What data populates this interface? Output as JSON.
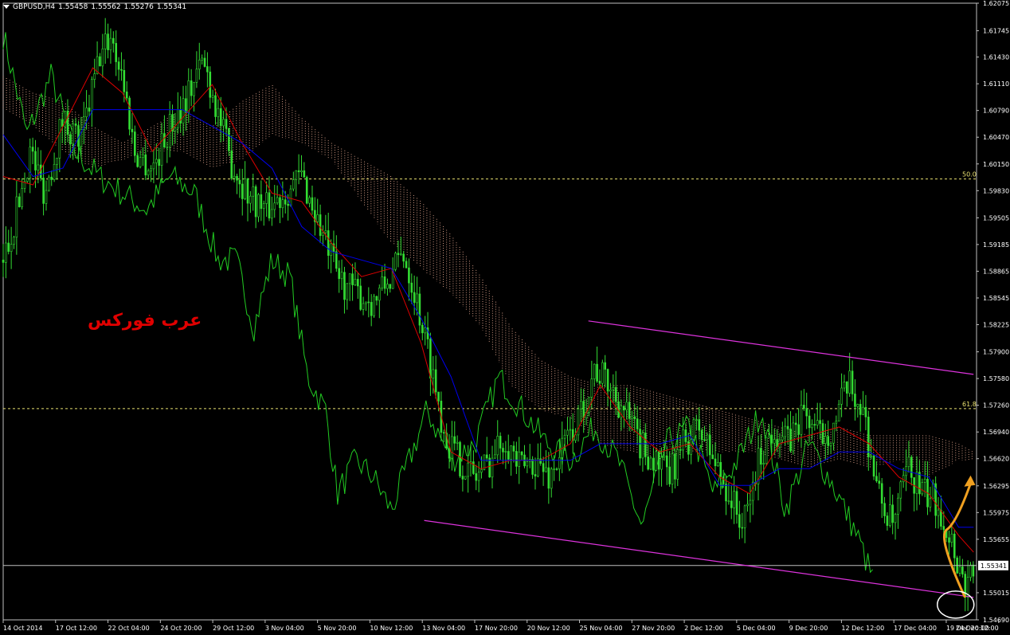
{
  "header": {
    "symbol": "GBPUSD,H4",
    "open": "1.55458",
    "high": "1.55562",
    "low": "1.55276",
    "close": "1.55341"
  },
  "watermark": "عرب فوركس",
  "colors": {
    "background": "#000000",
    "price": "#33dd33",
    "tenkan": "#dd0000",
    "kijun": "#0000ee",
    "chikou": "#22cc22",
    "cloud_bull": "#f5b49a",
    "cloud_bear": "#dddddd",
    "channel": "#dd33dd",
    "arrow": "#f0a020",
    "fib": "#e8e070",
    "current_price_line": "#c0c0c0"
  },
  "icons": {
    "menu": "triangle-down-icon",
    "forecast": "curved-arrow-icon",
    "highlight": "ellipse-marker"
  },
  "chart_data": {
    "type": "candlestick",
    "instrument": "GBPUSD",
    "timeframe": "H4",
    "ylim": [
      1.5469,
      1.62075
    ],
    "y_ticks": [
      "1.62075",
      "1.61745",
      "1.61430",
      "1.61110",
      "1.60790",
      "1.60470",
      "1.60150",
      "1.59830",
      "1.59505",
      "1.59185",
      "1.58865",
      "1.58545",
      "1.58225",
      "1.57900",
      "1.57580",
      "1.57260",
      "1.56940",
      "1.56620",
      "1.56295",
      "1.55975",
      "1.55655",
      "1.55015",
      "1.54690"
    ],
    "x_labels": [
      "14 Oct 2014",
      "17 Oct 12:00",
      "22 Oct 04:00",
      "24 Oct 20:00",
      "29 Oct 12:00",
      "3 Nov 04:00",
      "5 Nov 20:00",
      "10 Nov 12:00",
      "13 Nov 04:00",
      "17 Nov 20:00",
      "20 Nov 12:00",
      "25 Nov 04:00",
      "27 Nov 20:00",
      "2 Dec 12:00",
      "5 Dec 04:00",
      "9 Dec 20:00",
      "12 Dec 12:00",
      "17 Dec 04:00",
      "19 Dec 20:00",
      "24 Dec 12:00"
    ],
    "current_price": 1.55341,
    "current_price_label": "1.55341",
    "fib_levels": [
      {
        "label": "50.0",
        "price": 1.5997
      },
      {
        "label": "61.8",
        "price": 1.5722
      }
    ],
    "close_path": [
      {
        "t": 0,
        "p": 1.59
      },
      {
        "t": 4,
        "p": 1.595
      },
      {
        "t": 9,
        "p": 1.603
      },
      {
        "t": 14,
        "p": 1.598
      },
      {
        "t": 20,
        "p": 1.607
      },
      {
        "t": 26,
        "p": 1.604
      },
      {
        "t": 32,
        "p": 1.614
      },
      {
        "t": 36,
        "p": 1.617
      },
      {
        "t": 40,
        "p": 1.612
      },
      {
        "t": 44,
        "p": 1.603
      },
      {
        "t": 50,
        "p": 1.601
      },
      {
        "t": 56,
        "p": 1.606
      },
      {
        "t": 62,
        "p": 1.61
      },
      {
        "t": 67,
        "p": 1.614
      },
      {
        "t": 71,
        "p": 1.609
      },
      {
        "t": 76,
        "p": 1.602
      },
      {
        "t": 82,
        "p": 1.598
      },
      {
        "t": 88,
        "p": 1.596
      },
      {
        "t": 94,
        "p": 1.598
      },
      {
        "t": 100,
        "p": 1.6
      },
      {
        "t": 106,
        "p": 1.594
      },
      {
        "t": 112,
        "p": 1.588
      },
      {
        "t": 118,
        "p": 1.586
      },
      {
        "t": 124,
        "p": 1.585
      },
      {
        "t": 130,
        "p": 1.588
      },
      {
        "t": 134,
        "p": 1.591
      },
      {
        "t": 138,
        "p": 1.586
      },
      {
        "t": 143,
        "p": 1.578
      },
      {
        "t": 148,
        "p": 1.569
      },
      {
        "t": 153,
        "p": 1.566
      },
      {
        "t": 158,
        "p": 1.564
      },
      {
        "t": 163,
        "p": 1.566
      },
      {
        "t": 168,
        "p": 1.569
      },
      {
        "t": 173,
        "p": 1.565
      },
      {
        "t": 178,
        "p": 1.566
      },
      {
        "t": 183,
        "p": 1.564
      },
      {
        "t": 188,
        "p": 1.568
      },
      {
        "t": 193,
        "p": 1.571
      },
      {
        "t": 198,
        "p": 1.577
      },
      {
        "t": 203,
        "p": 1.575
      },
      {
        "t": 208,
        "p": 1.572
      },
      {
        "t": 213,
        "p": 1.568
      },
      {
        "t": 218,
        "p": 1.566
      },
      {
        "t": 223,
        "p": 1.564
      },
      {
        "t": 228,
        "p": 1.568
      },
      {
        "t": 233,
        "p": 1.57
      },
      {
        "t": 238,
        "p": 1.566
      },
      {
        "t": 243,
        "p": 1.562
      },
      {
        "t": 248,
        "p": 1.558
      },
      {
        "t": 253,
        "p": 1.566
      },
      {
        "t": 258,
        "p": 1.57
      },
      {
        "t": 263,
        "p": 1.568
      },
      {
        "t": 268,
        "p": 1.572
      },
      {
        "t": 273,
        "p": 1.569
      },
      {
        "t": 278,
        "p": 1.57
      },
      {
        "t": 283,
        "p": 1.575
      },
      {
        "t": 288,
        "p": 1.572
      },
      {
        "t": 293,
        "p": 1.562
      },
      {
        "t": 298,
        "p": 1.558
      },
      {
        "t": 303,
        "p": 1.565
      },
      {
        "t": 308,
        "p": 1.562
      },
      {
        "t": 313,
        "p": 1.561
      },
      {
        "t": 318,
        "p": 1.556
      },
      {
        "t": 322,
        "p": 1.551
      },
      {
        "t": 325,
        "p": 1.5534
      }
    ],
    "tenkan_path": [
      {
        "t": 0,
        "p": 1.6
      },
      {
        "t": 10,
        "p": 1.599
      },
      {
        "t": 20,
        "p": 1.606
      },
      {
        "t": 30,
        "p": 1.613
      },
      {
        "t": 40,
        "p": 1.61
      },
      {
        "t": 50,
        "p": 1.603
      },
      {
        "t": 60,
        "p": 1.607
      },
      {
        "t": 70,
        "p": 1.611
      },
      {
        "t": 80,
        "p": 1.604
      },
      {
        "t": 90,
        "p": 1.598
      },
      {
        "t": 100,
        "p": 1.597
      },
      {
        "t": 110,
        "p": 1.592
      },
      {
        "t": 120,
        "p": 1.588
      },
      {
        "t": 130,
        "p": 1.589
      },
      {
        "t": 140,
        "p": 1.58
      },
      {
        "t": 150,
        "p": 1.567
      },
      {
        "t": 160,
        "p": 1.565
      },
      {
        "t": 170,
        "p": 1.566
      },
      {
        "t": 180,
        "p": 1.566
      },
      {
        "t": 190,
        "p": 1.568
      },
      {
        "t": 200,
        "p": 1.575
      },
      {
        "t": 210,
        "p": 1.57
      },
      {
        "t": 220,
        "p": 1.567
      },
      {
        "t": 230,
        "p": 1.568
      },
      {
        "t": 240,
        "p": 1.564
      },
      {
        "t": 250,
        "p": 1.562
      },
      {
        "t": 260,
        "p": 1.568
      },
      {
        "t": 270,
        "p": 1.569
      },
      {
        "t": 280,
        "p": 1.57
      },
      {
        "t": 290,
        "p": 1.568
      },
      {
        "t": 300,
        "p": 1.564
      },
      {
        "t": 310,
        "p": 1.562
      },
      {
        "t": 320,
        "p": 1.557
      },
      {
        "t": 325,
        "p": 1.555
      }
    ],
    "kijun_path": [
      {
        "t": 0,
        "p": 1.605
      },
      {
        "t": 10,
        "p": 1.6
      },
      {
        "t": 20,
        "p": 1.601
      },
      {
        "t": 30,
        "p": 1.608
      },
      {
        "t": 40,
        "p": 1.608
      },
      {
        "t": 50,
        "p": 1.608
      },
      {
        "t": 60,
        "p": 1.608
      },
      {
        "t": 70,
        "p": 1.606
      },
      {
        "t": 80,
        "p": 1.604
      },
      {
        "t": 90,
        "p": 1.601
      },
      {
        "t": 100,
        "p": 1.594
      },
      {
        "t": 110,
        "p": 1.591
      },
      {
        "t": 120,
        "p": 1.59
      },
      {
        "t": 130,
        "p": 1.589
      },
      {
        "t": 140,
        "p": 1.583
      },
      {
        "t": 150,
        "p": 1.576
      },
      {
        "t": 160,
        "p": 1.566
      },
      {
        "t": 170,
        "p": 1.566
      },
      {
        "t": 180,
        "p": 1.566
      },
      {
        "t": 190,
        "p": 1.566
      },
      {
        "t": 200,
        "p": 1.568
      },
      {
        "t": 210,
        "p": 1.568
      },
      {
        "t": 220,
        "p": 1.568
      },
      {
        "t": 230,
        "p": 1.569
      },
      {
        "t": 240,
        "p": 1.563
      },
      {
        "t": 250,
        "p": 1.563
      },
      {
        "t": 260,
        "p": 1.565
      },
      {
        "t": 270,
        "p": 1.565
      },
      {
        "t": 280,
        "p": 1.567
      },
      {
        "t": 290,
        "p": 1.567
      },
      {
        "t": 300,
        "p": 1.565
      },
      {
        "t": 310,
        "p": 1.564
      },
      {
        "t": 320,
        "p": 1.558
      },
      {
        "t": 325,
        "p": 1.558
      }
    ],
    "chikou_path": [
      {
        "t": 0,
        "p": 1.617
      },
      {
        "t": 8,
        "p": 1.605
      },
      {
        "t": 16,
        "p": 1.612
      },
      {
        "t": 24,
        "p": 1.603
      },
      {
        "t": 32,
        "p": 1.6
      },
      {
        "t": 40,
        "p": 1.598
      },
      {
        "t": 48,
        "p": 1.596
      },
      {
        "t": 56,
        "p": 1.6
      },
      {
        "t": 64,
        "p": 1.598
      },
      {
        "t": 72,
        "p": 1.59
      },
      {
        "t": 78,
        "p": 1.59
      },
      {
        "t": 84,
        "p": 1.582
      },
      {
        "t": 90,
        "p": 1.59
      },
      {
        "t": 96,
        "p": 1.588
      },
      {
        "t": 102,
        "p": 1.576
      },
      {
        "t": 108,
        "p": 1.572
      },
      {
        "t": 112,
        "p": 1.562
      },
      {
        "t": 118,
        "p": 1.566
      },
      {
        "t": 124,
        "p": 1.564
      },
      {
        "t": 130,
        "p": 1.56
      },
      {
        "t": 136,
        "p": 1.566
      },
      {
        "t": 142,
        "p": 1.572
      },
      {
        "t": 150,
        "p": 1.566
      },
      {
        "t": 158,
        "p": 1.568
      },
      {
        "t": 166,
        "p": 1.576
      },
      {
        "t": 174,
        "p": 1.572
      },
      {
        "t": 182,
        "p": 1.568
      },
      {
        "t": 190,
        "p": 1.566
      },
      {
        "t": 198,
        "p": 1.57
      },
      {
        "t": 206,
        "p": 1.566
      },
      {
        "t": 214,
        "p": 1.558
      },
      {
        "t": 222,
        "p": 1.568
      },
      {
        "t": 230,
        "p": 1.57
      },
      {
        "t": 238,
        "p": 1.562
      },
      {
        "t": 246,
        "p": 1.566
      },
      {
        "t": 254,
        "p": 1.572
      },
      {
        "t": 262,
        "p": 1.56
      },
      {
        "t": 270,
        "p": 1.568
      },
      {
        "t": 278,
        "p": 1.563
      },
      {
        "t": 286,
        "p": 1.557
      },
      {
        "t": 292,
        "p": 1.551
      }
    ],
    "cloud": [
      {
        "t": 0,
        "a": 1.612,
        "b": 1.608
      },
      {
        "t": 10,
        "a": 1.61,
        "b": 1.606
      },
      {
        "t": 20,
        "a": 1.609,
        "b": 1.603
      },
      {
        "t": 30,
        "a": 1.606,
        "b": 1.601
      },
      {
        "t": 40,
        "a": 1.604,
        "b": 1.602
      },
      {
        "t": 50,
        "a": 1.606,
        "b": 1.603
      },
      {
        "t": 60,
        "a": 1.608,
        "b": 1.603
      },
      {
        "t": 70,
        "a": 1.606,
        "b": 1.601
      },
      {
        "t": 80,
        "a": 1.609,
        "b": 1.602
      },
      {
        "t": 90,
        "a": 1.611,
        "b": 1.605
      },
      {
        "t": 100,
        "a": 1.607,
        "b": 1.604
      },
      {
        "t": 110,
        "a": 1.604,
        "b": 1.602
      },
      {
        "t": 120,
        "a": 1.602,
        "b": 1.597
      },
      {
        "t": 130,
        "a": 1.6,
        "b": 1.592
      },
      {
        "t": 140,
        "a": 1.597,
        "b": 1.589
      },
      {
        "t": 150,
        "a": 1.593,
        "b": 1.586
      },
      {
        "t": 160,
        "a": 1.588,
        "b": 1.582
      },
      {
        "t": 170,
        "a": 1.582,
        "b": 1.575
      },
      {
        "t": 180,
        "a": 1.578,
        "b": 1.572
      },
      {
        "t": 190,
        "a": 1.576,
        "b": 1.571
      },
      {
        "t": 200,
        "a": 1.575,
        "b": 1.568
      },
      {
        "t": 210,
        "a": 1.575,
        "b": 1.567
      },
      {
        "t": 220,
        "a": 1.574,
        "b": 1.566
      },
      {
        "t": 230,
        "a": 1.573,
        "b": 1.567
      },
      {
        "t": 240,
        "a": 1.572,
        "b": 1.567
      },
      {
        "t": 250,
        "a": 1.571,
        "b": 1.567
      },
      {
        "t": 260,
        "a": 1.57,
        "b": 1.566
      },
      {
        "t": 270,
        "a": 1.569,
        "b": 1.565
      },
      {
        "t": 280,
        "a": 1.57,
        "b": 1.566
      },
      {
        "t": 290,
        "a": 1.569,
        "b": 1.565
      },
      {
        "t": 300,
        "a": 1.569,
        "b": 1.566
      },
      {
        "t": 310,
        "a": 1.569,
        "b": 1.564
      },
      {
        "t": 320,
        "a": 1.568,
        "b": 1.566
      },
      {
        "t": 325,
        "a": 1.567,
        "b": 1.566
      }
    ],
    "channel_lines": [
      {
        "t1": 196,
        "p1": 1.5827,
        "t2": 325,
        "p2": 1.5763
      },
      {
        "t1": 141,
        "p1": 1.5588,
        "t2": 325,
        "p2": 1.5496
      }
    ],
    "forecast_arrow": {
      "start": {
        "t": 322,
        "p": 1.5497
      },
      "peak": {
        "t": 316,
        "p": 1.5577
      },
      "end": {
        "t": 324,
        "p": 1.564
      }
    },
    "highlight_ellipse": {
      "t": 319,
      "p": 1.5493
    }
  }
}
